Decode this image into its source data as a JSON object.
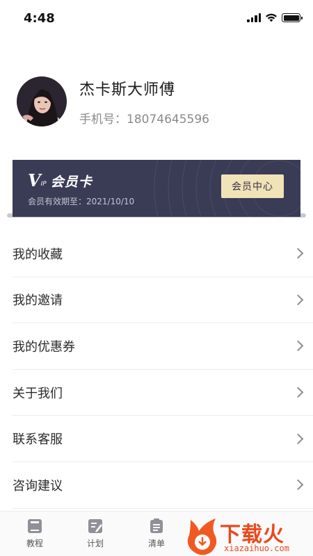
{
  "status_bar": {
    "time": "4:48"
  },
  "profile": {
    "name": "杰卡斯大师傅",
    "phone_label": "手机号：18074645596"
  },
  "vip_card": {
    "logo_v": "V",
    "logo_ip": "IP",
    "title": "会员卡",
    "expiry": "会员有效期至：2021/10/10",
    "center_button": "会员中心",
    "colors": {
      "background": "#3a3b55",
      "button": "#f0e3b8"
    }
  },
  "menu": {
    "items": [
      {
        "label": "我的收藏"
      },
      {
        "label": "我的邀请"
      },
      {
        "label": "我的优惠券"
      },
      {
        "label": "关于我们"
      },
      {
        "label": "联系客服"
      },
      {
        "label": "咨询建议"
      }
    ]
  },
  "tab_bar": {
    "tabs": [
      {
        "label": "教程",
        "icon": "book-icon"
      },
      {
        "label": "计划",
        "icon": "edit-icon"
      },
      {
        "label": "清单",
        "icon": "list-icon"
      }
    ]
  },
  "watermark": {
    "text": "下载火",
    "sub": "xiazaihuo.com"
  }
}
